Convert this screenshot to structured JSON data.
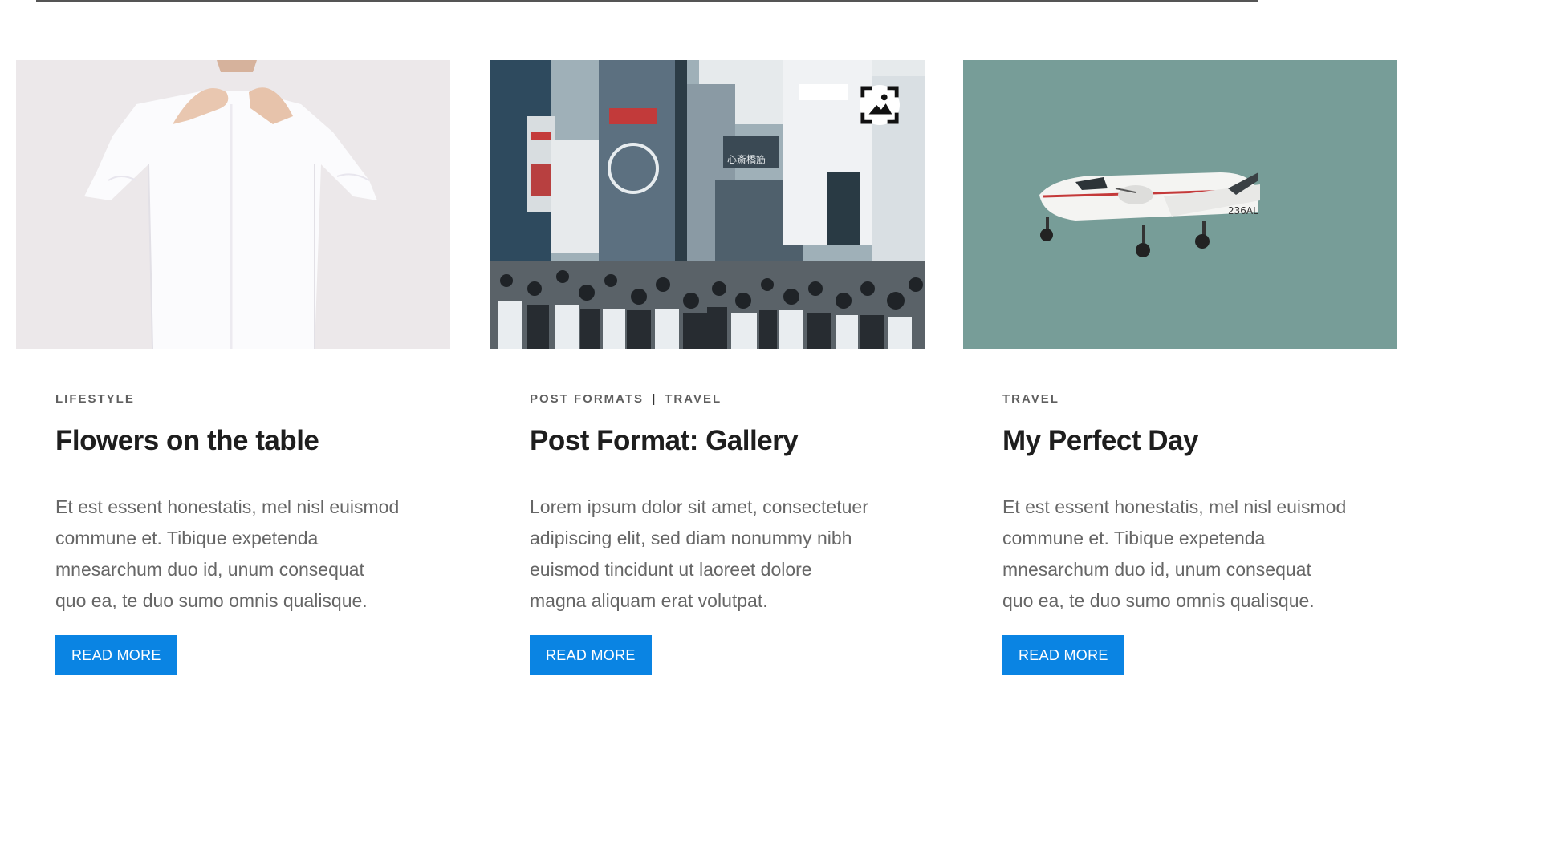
{
  "posts": [
    {
      "category_1": "LIFESTYLE",
      "title": "Flowers on the table",
      "excerpt_lines": [
        "Et est essent honestatis, mel nisl euismod",
        "commune et. Tibique expetenda",
        "mnesarchum duo id, unum consequat",
        "quo ea, te duo sumo omnis qualisque."
      ],
      "button_label": "READ MORE",
      "image": "man-buttoning-white-shirt"
    },
    {
      "category_1": "POST FORMATS",
      "category_separator": "|",
      "category_2": "TRAVEL",
      "title": "Post Format: Gallery",
      "excerpt_lines": [
        "Lorem ipsum dolor sit amet, consectetuer",
        "adipiscing elit, sed diam nonummy nibh",
        "euismod tincidunt ut laoreet dolore",
        "magna aliquam erat volutpat."
      ],
      "button_label": "READ MORE",
      "image": "crowded-city-street",
      "format_icon": "gallery-icon"
    },
    {
      "category_1": "TRAVEL",
      "title": "My Perfect Day",
      "excerpt_lines": [
        "Et est essent honestatis, mel nisl euismod",
        "commune et. Tibique expetenda",
        "mnesarchum duo id, unum consequat",
        "quo ea, te duo sumo omnis qualisque."
      ],
      "button_label": "READ MORE",
      "image": "white-airplane-in-sky"
    }
  ],
  "colors": {
    "button_bg": "#0a84e3",
    "button_text": "#ffffff",
    "title": "#1e1e1e",
    "category": "#5f5f5f",
    "excerpt": "#666666"
  }
}
